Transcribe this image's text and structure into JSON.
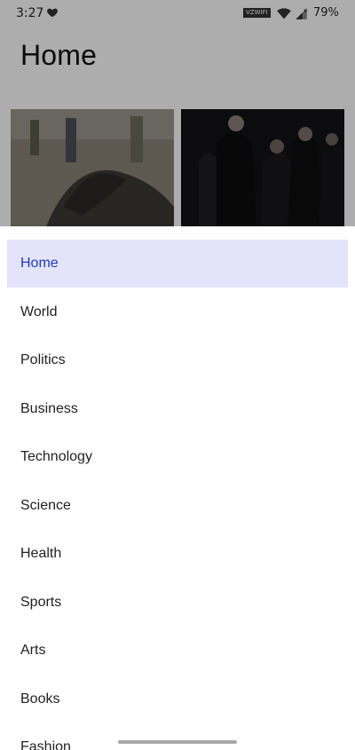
{
  "status_bar": {
    "time": "3:27",
    "wifi_badge": "VZWIFI",
    "battery": "79%"
  },
  "header": {
    "title": "Home"
  },
  "menu": {
    "selected_index": 0,
    "items": [
      {
        "label": "Home"
      },
      {
        "label": "World"
      },
      {
        "label": "Politics"
      },
      {
        "label": "Business"
      },
      {
        "label": "Technology"
      },
      {
        "label": "Science"
      },
      {
        "label": "Health"
      },
      {
        "label": "Sports"
      },
      {
        "label": "Arts"
      },
      {
        "label": "Books"
      },
      {
        "label": "Fashion"
      }
    ]
  },
  "colors": {
    "selected_bg": "#e3e4fc",
    "selected_text": "#1f3bb5",
    "text": "#222222"
  },
  "icons": [
    "heart-icon",
    "wifi-icon",
    "signal-icon"
  ]
}
